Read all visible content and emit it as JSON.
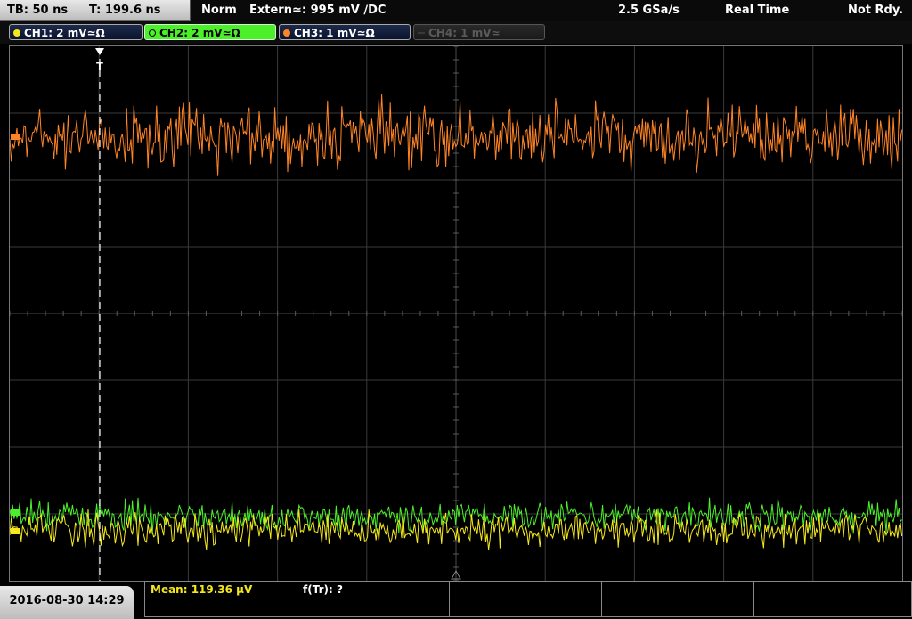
{
  "topbar": {
    "timebase": "TB: 50 ns",
    "trigger_time": "T: 199.6 ns",
    "mode": "Norm",
    "trigger": "Extern≃: 995 mV ∕DC",
    "sample_rate": "2.5 GSa/s",
    "acq_mode": "Real Time",
    "status": "Not Rdy."
  },
  "channels": [
    {
      "label": "CH1: 2 mV≃Ω",
      "color": "#f5e81c",
      "state": "on"
    },
    {
      "label": "CH2: 2 mV≃Ω",
      "color": "#4cf02a",
      "state": "active"
    },
    {
      "label": "CH3: 1 mV≃Ω",
      "color": "#ff8426",
      "state": "on"
    },
    {
      "label": "CH4: 1 mV≃",
      "color": "#5a5a5a",
      "state": "disabled"
    }
  ],
  "trigger_marker": "T",
  "bottom": {
    "datetime": "2016-08-30 14:29",
    "meas1": "Mean: 119.36 µV",
    "meas2": "f(Tr): ?"
  },
  "colors": {
    "ch1": "#f5e81c",
    "ch2": "#4cf02a",
    "ch3": "#ff8426",
    "grid": "#3a3a3a",
    "background": "#000000"
  }
}
